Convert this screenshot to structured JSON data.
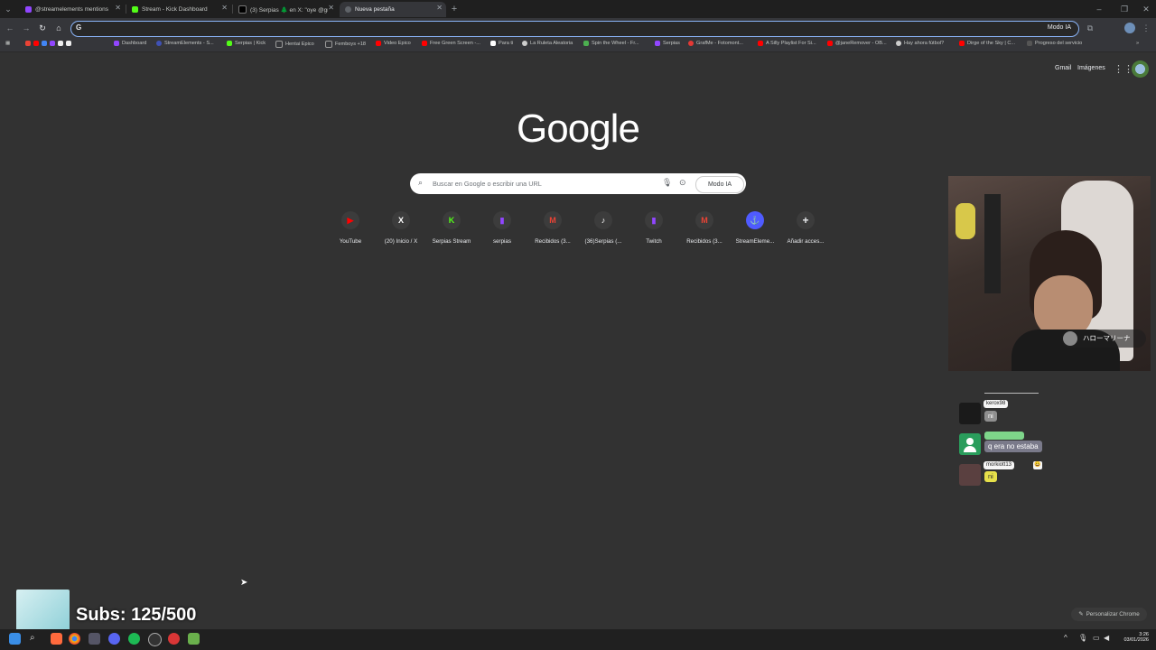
{
  "tabs": [
    {
      "title": "@streamelements mentions",
      "color": "#9146ff"
    },
    {
      "title": "Stream - Kick Dashboard",
      "color": "#53fc18"
    },
    {
      "title": "(3) Serpias 🌲 en X: \"oye @gro",
      "color": "#000000"
    },
    {
      "title": "Nueva pestaña",
      "color": "#5f6368"
    }
  ],
  "new_tab_label": "+",
  "toolbar": {
    "back": "←",
    "forward": "→",
    "reload": "↻",
    "home": "⌂",
    "omnibox_g": "G",
    "modo_ia": "Modo IA"
  },
  "bookmarks": [
    {
      "label": "Dashboard",
      "color": "#9146ff"
    },
    {
      "label": "StreamElements - S...",
      "color": "#3f51b5"
    },
    {
      "label": "Serpias | Kick",
      "color": "#53fc18"
    },
    {
      "label": "Hentai Epico",
      "color": "#888888"
    },
    {
      "label": "Femboys +18",
      "color": "#888888"
    },
    {
      "label": "Video Epico",
      "color": "#ff0000"
    },
    {
      "label": "Free Green Screen -...",
      "color": "#ff0000"
    },
    {
      "label": "Para ti",
      "color": "#ffffff"
    },
    {
      "label": "La Ruleta Aleatoria",
      "color": "#cccccc"
    },
    {
      "label": "Spin the Wheel - Fr...",
      "color": "#4caf50"
    },
    {
      "label": "Serpias",
      "color": "#9146ff"
    },
    {
      "label": "GrafMe - Fotomont...",
      "color": "#e53935"
    },
    {
      "label": "A Silly Playlist For Si...",
      "color": "#ff0000"
    },
    {
      "label": "@janeRemover - OB...",
      "color": "#ff0000"
    },
    {
      "label": "Hay ahora fútbol?",
      "color": "#cccccc"
    },
    {
      "label": "Dirge of the Sky | C...",
      "color": "#ff0000"
    },
    {
      "label": "Progreso del servicio",
      "color": "#555555"
    }
  ],
  "top_links": {
    "gmail": "Gmail",
    "images": "Imágenes"
  },
  "google_logo": "Google",
  "search": {
    "placeholder": "Buscar en Google o escribir una URL",
    "modo_ia": "Modo IA"
  },
  "shortcuts": [
    {
      "label": "YouTube",
      "glyph": "▶",
      "color": "#ff0000"
    },
    {
      "label": "(20) Inicio / X",
      "glyph": "X",
      "color": "#ffffff"
    },
    {
      "label": "Serpias Stream",
      "glyph": "K",
      "color": "#53fc18"
    },
    {
      "label": "serpias",
      "glyph": "▮",
      "color": "#9146ff"
    },
    {
      "label": "Recibidos (3...",
      "glyph": "M",
      "color": "#ea4335"
    },
    {
      "label": "(36)Serpias (...",
      "glyph": "♪",
      "color": "#ffffff"
    },
    {
      "label": "Twitch",
      "glyph": "▮",
      "color": "#9146ff"
    },
    {
      "label": "Recibidos (3...",
      "glyph": "M",
      "color": "#ea4335"
    },
    {
      "label": "StreamEleme...",
      "glyph": "⚓",
      "color": "#4f5bff"
    },
    {
      "label": "Añadir acces...",
      "glyph": "+",
      "color": "#e8eaed"
    }
  ],
  "webcam": {
    "overlay_text": "ハローマリーナ"
  },
  "chat": [
    {
      "user": "kerox98",
      "message": "ni",
      "msg_color": "#8f8f8f"
    },
    {
      "user": "",
      "message": "q era no estaba",
      "msg_color": "#7a7a8a"
    },
    {
      "user": "morkiott13",
      "message": "ni",
      "msg_color": "#e6e04a"
    }
  ],
  "subs": {
    "text": "Subs: 125/500"
  },
  "customize": "Personalizar Chrome",
  "clock": {
    "time": "3:26",
    "date": "03/01/2026"
  }
}
